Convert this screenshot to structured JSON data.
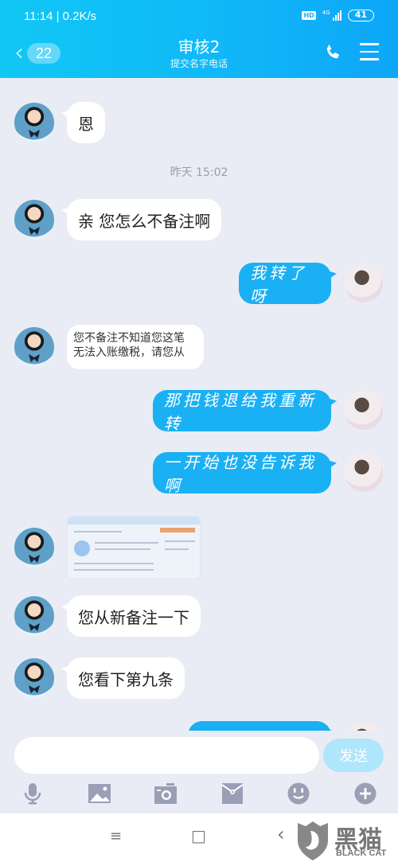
{
  "status_bar": {
    "time_speed": "11:14 | 0.2K/s",
    "hd_label": "HD",
    "network_label": "4G",
    "battery": "41"
  },
  "header": {
    "unread_count": "22",
    "title": "审核2",
    "subtitle": "提交名字电话",
    "back_icon": "chevron-left-icon",
    "call_icon": "phone-icon",
    "menu_icon": "hamburger-menu-icon"
  },
  "chat": {
    "timestamp": "昨天 15:02",
    "messages": [
      {
        "sender": "agent",
        "type": "text",
        "text": "恩"
      },
      {
        "sender": "agent",
        "type": "text",
        "text": "亲 您怎么不备注啊"
      },
      {
        "sender": "me",
        "type": "text",
        "text": "我转了呀"
      },
      {
        "sender": "agent",
        "type": "image-text",
        "lines": [
          "您不备注不知道您这笔",
          "无法入账缴税，请您从"
        ]
      },
      {
        "sender": "me",
        "type": "text",
        "text": "那把钱退给我重新转"
      },
      {
        "sender": "me",
        "type": "text",
        "text": "一开始也没告诉我啊"
      },
      {
        "sender": "agent",
        "type": "image",
        "alt": "screenshot"
      },
      {
        "sender": "agent",
        "type": "text",
        "text": "您从新备注一下"
      },
      {
        "sender": "agent",
        "type": "text",
        "text": "您看下第九条"
      },
      {
        "sender": "me",
        "type": "text",
        "text": ""
      }
    ]
  },
  "composer": {
    "input_value": "",
    "input_placeholder": "",
    "send_label": "发送",
    "tools": [
      "microphone-icon",
      "image-icon",
      "camera-icon",
      "red-packet-icon",
      "emoji-icon",
      "plus-icon"
    ]
  },
  "system_nav": {
    "menu_icon": "≡",
    "home_icon": "□",
    "back_icon": "‹"
  },
  "watermark": {
    "cn": "黑猫",
    "en": "BLACK CAT"
  },
  "colors": {
    "header_start": "#11c7f5",
    "header_end": "#0ea6f8",
    "outgoing_bubble": "#1ab0f4",
    "send_button": "#aee6fb",
    "background": "#e9ecf4"
  }
}
